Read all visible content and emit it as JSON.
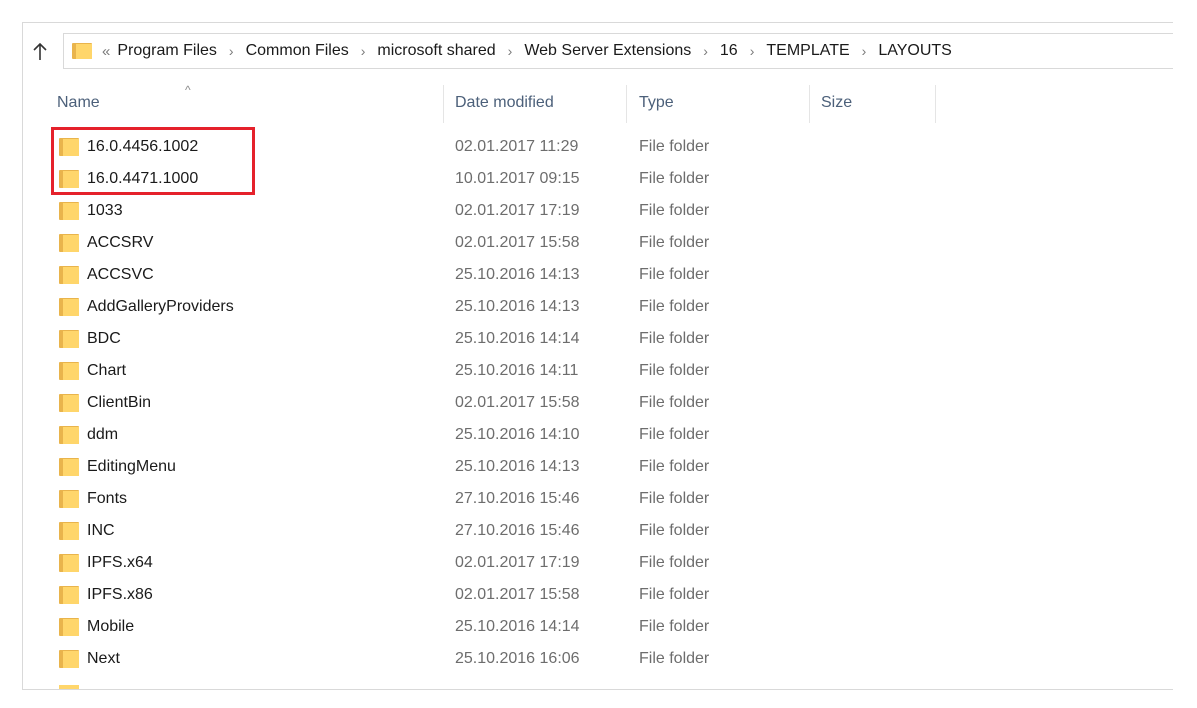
{
  "navigation": {
    "up_icon": "up-arrow-icon",
    "overflow_chevron": "«",
    "separator_glyph": "›",
    "breadcrumb": [
      "Program Files",
      "Common Files",
      "microsoft shared",
      "Web Server Extensions",
      "16",
      "TEMPLATE",
      "LAYOUTS"
    ]
  },
  "columns": {
    "name": "Name",
    "date_modified": "Date modified",
    "type": "Type",
    "size": "Size",
    "sort_indicator": "^"
  },
  "files": [
    {
      "name": "16.0.4456.1002",
      "date": "02.01.2017 11:29",
      "type": "File folder"
    },
    {
      "name": "16.0.4471.1000",
      "date": "10.01.2017 09:15",
      "type": "File folder"
    },
    {
      "name": "1033",
      "date": "02.01.2017 17:19",
      "type": "File folder"
    },
    {
      "name": "ACCSRV",
      "date": "02.01.2017 15:58",
      "type": "File folder"
    },
    {
      "name": "ACCSVC",
      "date": "25.10.2016 14:13",
      "type": "File folder"
    },
    {
      "name": "AddGalleryProviders",
      "date": "25.10.2016 14:13",
      "type": "File folder"
    },
    {
      "name": "BDC",
      "date": "25.10.2016 14:14",
      "type": "File folder"
    },
    {
      "name": "Chart",
      "date": "25.10.2016 14:11",
      "type": "File folder"
    },
    {
      "name": "ClientBin",
      "date": "02.01.2017 15:58",
      "type": "File folder"
    },
    {
      "name": "ddm",
      "date": "25.10.2016 14:10",
      "type": "File folder"
    },
    {
      "name": "EditingMenu",
      "date": "25.10.2016 14:13",
      "type": "File folder"
    },
    {
      "name": "Fonts",
      "date": "27.10.2016 15:46",
      "type": "File folder"
    },
    {
      "name": "INC",
      "date": "27.10.2016 15:46",
      "type": "File folder"
    },
    {
      "name": "IPFS.x64",
      "date": "02.01.2017 17:19",
      "type": "File folder"
    },
    {
      "name": "IPFS.x86",
      "date": "02.01.2017 15:58",
      "type": "File folder"
    },
    {
      "name": "Mobile",
      "date": "25.10.2016 14:14",
      "type": "File folder"
    },
    {
      "name": "Next",
      "date": "25.10.2016 16:06",
      "type": "File folder"
    }
  ],
  "folder_icon": "folder-icon",
  "colors": {
    "highlight": "#e5212b",
    "folder_front": "#ffd66b",
    "folder_back": "#e9b44c",
    "header_text": "#4c607a",
    "secondary_text": "#6d6d6d"
  }
}
